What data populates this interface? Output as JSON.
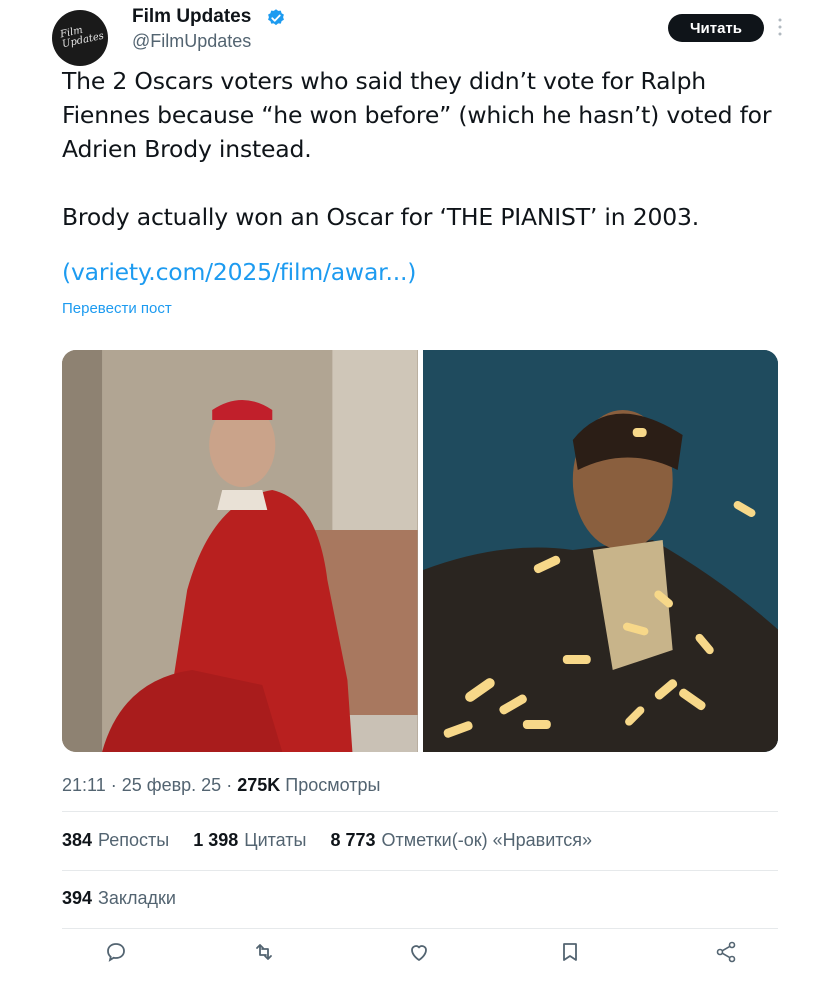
{
  "account": {
    "name": "Film Updates",
    "handle": "@FilmUpdates",
    "avatar_text": "Film\nUpdates",
    "verified_icon": "verified-badge-icon",
    "follow_label": "Читать"
  },
  "post": {
    "text": "The 2 Oscars voters who said they didn’t vote for Ralph\nFiennes because “he won before” (which he hasn’t) voted for\nAdrien Brody instead.\n\nBrody actually won an Oscar for ‘THE PIANIST’ in 2003.",
    "link": "(variety.com/2025/film/awar...)",
    "translate_label": "Перевести пост"
  },
  "meta": {
    "time": "21:11",
    "date": "25 февр. 25",
    "views_count": "275K",
    "views_label": "Просмотры"
  },
  "stats": {
    "reposts_count": "384",
    "reposts_label": "Репосты",
    "quotes_count": "1 398",
    "quotes_label": "Цитаты",
    "likes_count": "8 773",
    "likes_label": "Отметки(-ок) «Нравится»",
    "bookmarks_count": "394",
    "bookmarks_label": "Закладки"
  },
  "actions": [
    "reply-icon",
    "repost-icon",
    "like-icon",
    "bookmark-icon",
    "share-icon"
  ],
  "colors": {
    "accent": "#1d9bf0",
    "text": "#0f1419",
    "secondary": "#536471"
  }
}
